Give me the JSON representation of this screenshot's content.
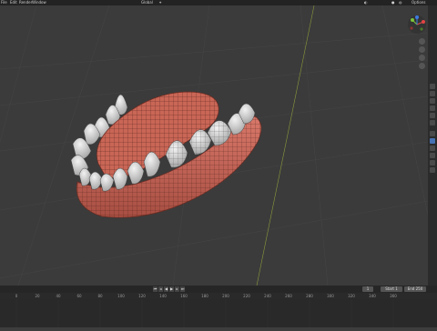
{
  "menu": {
    "items": [
      "File",
      "Edit",
      "Render",
      "Window",
      "Help"
    ]
  },
  "header": {
    "mode_label": "Global",
    "options_label": "Options"
  },
  "timeline": {
    "playback_glyphs": [
      "⏮",
      "◂",
      "◀",
      "▶",
      "▸",
      "⏭"
    ],
    "current_frame": "1",
    "start_label": "Start",
    "start_value": "1",
    "end_label": "End",
    "end_value": "250",
    "ruler_ticks": [
      "0",
      "20",
      "40",
      "60",
      "80",
      "100",
      "120",
      "140",
      "160",
      "180",
      "200",
      "220",
      "240",
      "260",
      "280",
      "300",
      "320",
      "340",
      "360"
    ]
  },
  "colors": {
    "accent": "#4772b3",
    "gum": "#c9675a",
    "tooth": "#dcdcdc",
    "viewport": "#3b3b3b"
  },
  "icons": [
    "grid-icon",
    "camera-icon",
    "hand-icon",
    "zoom-icon",
    "tool-icon",
    "view-icon",
    "object-icon",
    "modifier-icon",
    "material-icon"
  ]
}
